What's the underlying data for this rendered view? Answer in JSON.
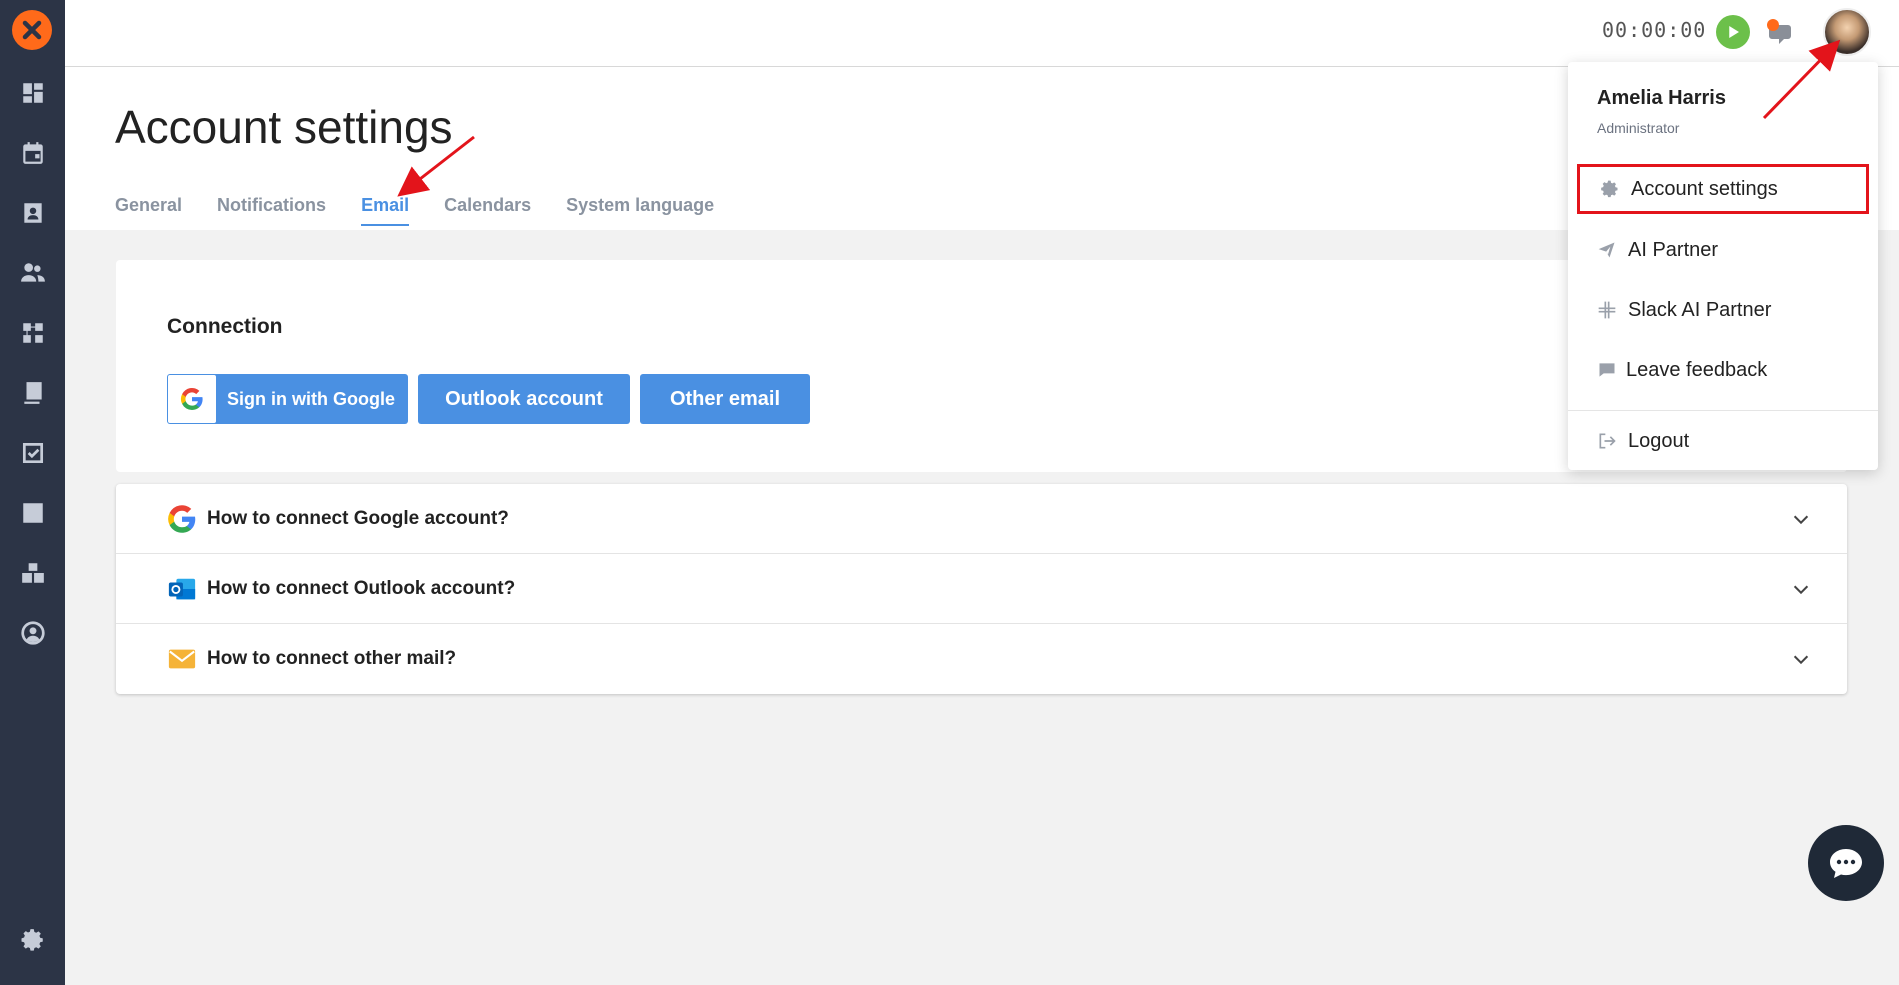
{
  "app": {
    "accent": "#4a90e2",
    "sidebar_color": "#2c3446",
    "logo_color": "#ff6a1a"
  },
  "sidebar": {
    "items": [
      {
        "icon": "dashboard-icon"
      },
      {
        "icon": "calendar-icon"
      },
      {
        "icon": "contacts-icon"
      },
      {
        "icon": "users-icon"
      },
      {
        "icon": "workflow-icon"
      },
      {
        "icon": "documents-icon"
      },
      {
        "icon": "tasks-icon"
      },
      {
        "icon": "reports-icon"
      },
      {
        "icon": "warehouse-icon"
      },
      {
        "icon": "profile-icon"
      },
      {
        "icon": "gear-icon"
      }
    ]
  },
  "topbar": {
    "timer": "00:00:00"
  },
  "page": {
    "title": "Account settings",
    "tabs": [
      {
        "label": "General",
        "active": false
      },
      {
        "label": "Notifications",
        "active": false
      },
      {
        "label": "Email",
        "active": true
      },
      {
        "label": "Calendars",
        "active": false
      },
      {
        "label": "System language",
        "active": false
      }
    ]
  },
  "connection": {
    "title": "Connection",
    "google_label": "Sign in with Google",
    "outlook_label": "Outlook account",
    "other_label": "Other email"
  },
  "faq": [
    {
      "icon": "google-icon",
      "text": "How to connect Google account?"
    },
    {
      "icon": "outlook-icon",
      "text": "How to connect Outlook account?"
    },
    {
      "icon": "mail-icon",
      "text": "How to connect other mail?"
    }
  ],
  "user_menu": {
    "name": "Amelia Harris",
    "role": "Administrator",
    "items": [
      {
        "icon": "gear-icon",
        "label": "Account settings"
      },
      {
        "icon": "send-icon",
        "label": "AI Partner"
      },
      {
        "icon": "slack-icon",
        "label": "Slack AI Partner"
      },
      {
        "icon": "comment-icon",
        "label": "Leave feedback"
      },
      {
        "icon": "logout-icon",
        "label": "Logout"
      }
    ]
  }
}
